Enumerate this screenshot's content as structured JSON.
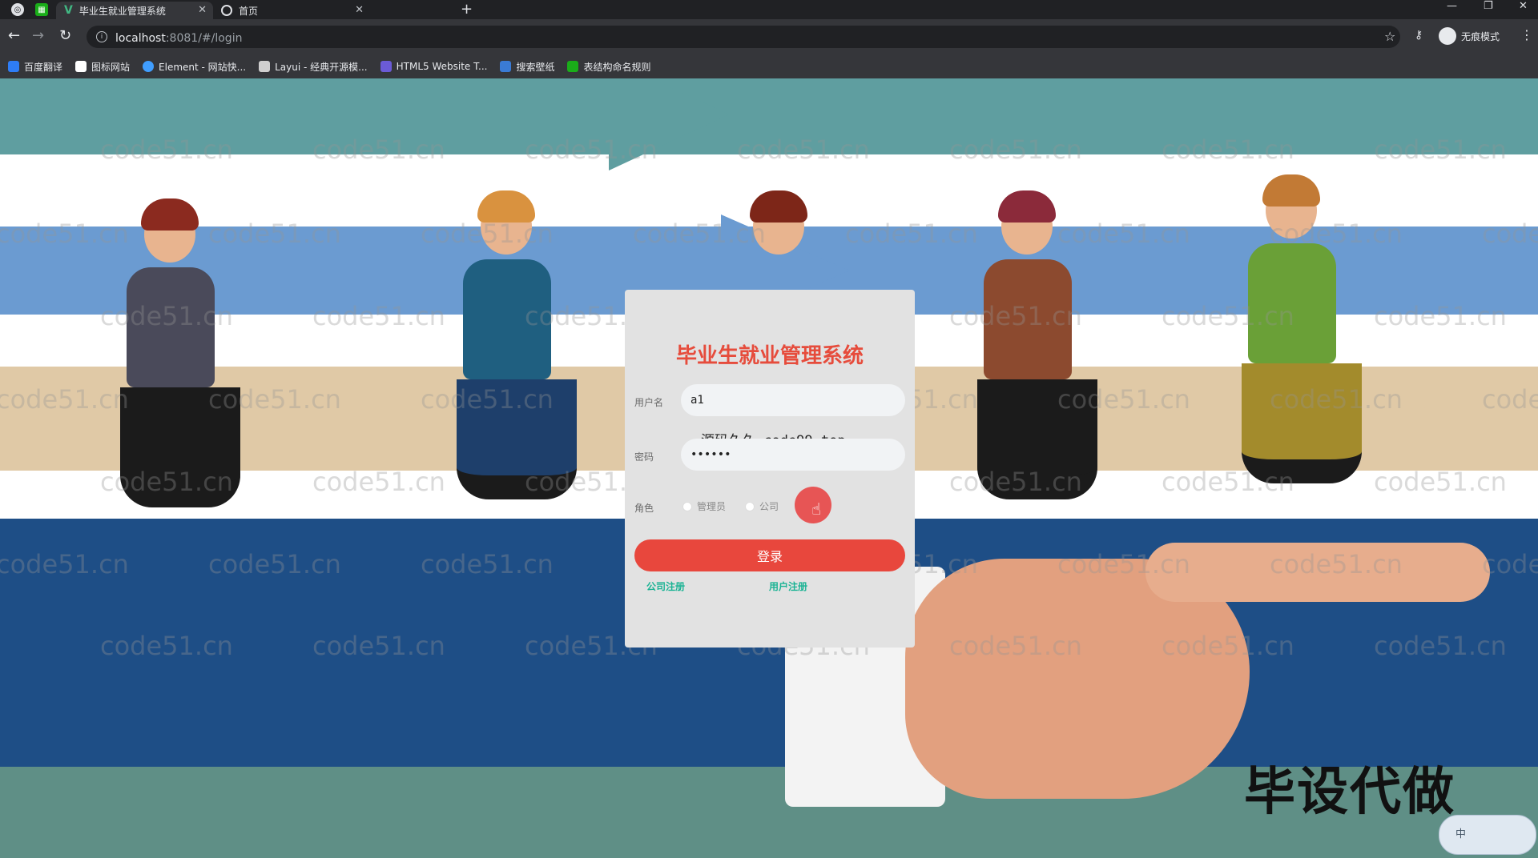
{
  "browser": {
    "tabs": [
      {
        "label": "毕业生就业管理系统",
        "active": true
      },
      {
        "label": "首页",
        "active": false
      }
    ],
    "url_host": "localhost",
    "url_path": ":8081/#/login",
    "profile_label": "无痕模式",
    "bookmarks": [
      {
        "label": "百度翻译",
        "color": "#2e7df6"
      },
      {
        "label": "图标网站",
        "color": "#ffffff"
      },
      {
        "label": "Element - 网站快...",
        "color": "#409eff"
      },
      {
        "label": "Layui - 经典开源模...",
        "color": "#cfcfcf"
      },
      {
        "label": "HTML5 Website T...",
        "color": "#6b5bd6"
      },
      {
        "label": "搜索壁纸",
        "color": "#3a7bd5"
      },
      {
        "label": "表结构命名规则",
        "color": "#1aad19"
      }
    ]
  },
  "login": {
    "title": "毕业生就业管理系统",
    "username_label": "用户名",
    "username_value": "a1",
    "password_label": "密码",
    "password_value": "••••••",
    "role_label": "角色",
    "roles": [
      {
        "label": "管理员",
        "selected": false
      },
      {
        "label": "公司",
        "selected": false
      }
    ],
    "login_button": "登录",
    "company_register": "公司注册",
    "user_register": "用户注册"
  },
  "overlays": {
    "source_text": "源码久久-code99.top",
    "watermark": "code51.cn",
    "promo_text": "毕设代做",
    "ime_label": "中"
  },
  "colors": {
    "title_red": "#e64c3c",
    "button_red": "#e8473d",
    "link_green": "#1bb394"
  }
}
